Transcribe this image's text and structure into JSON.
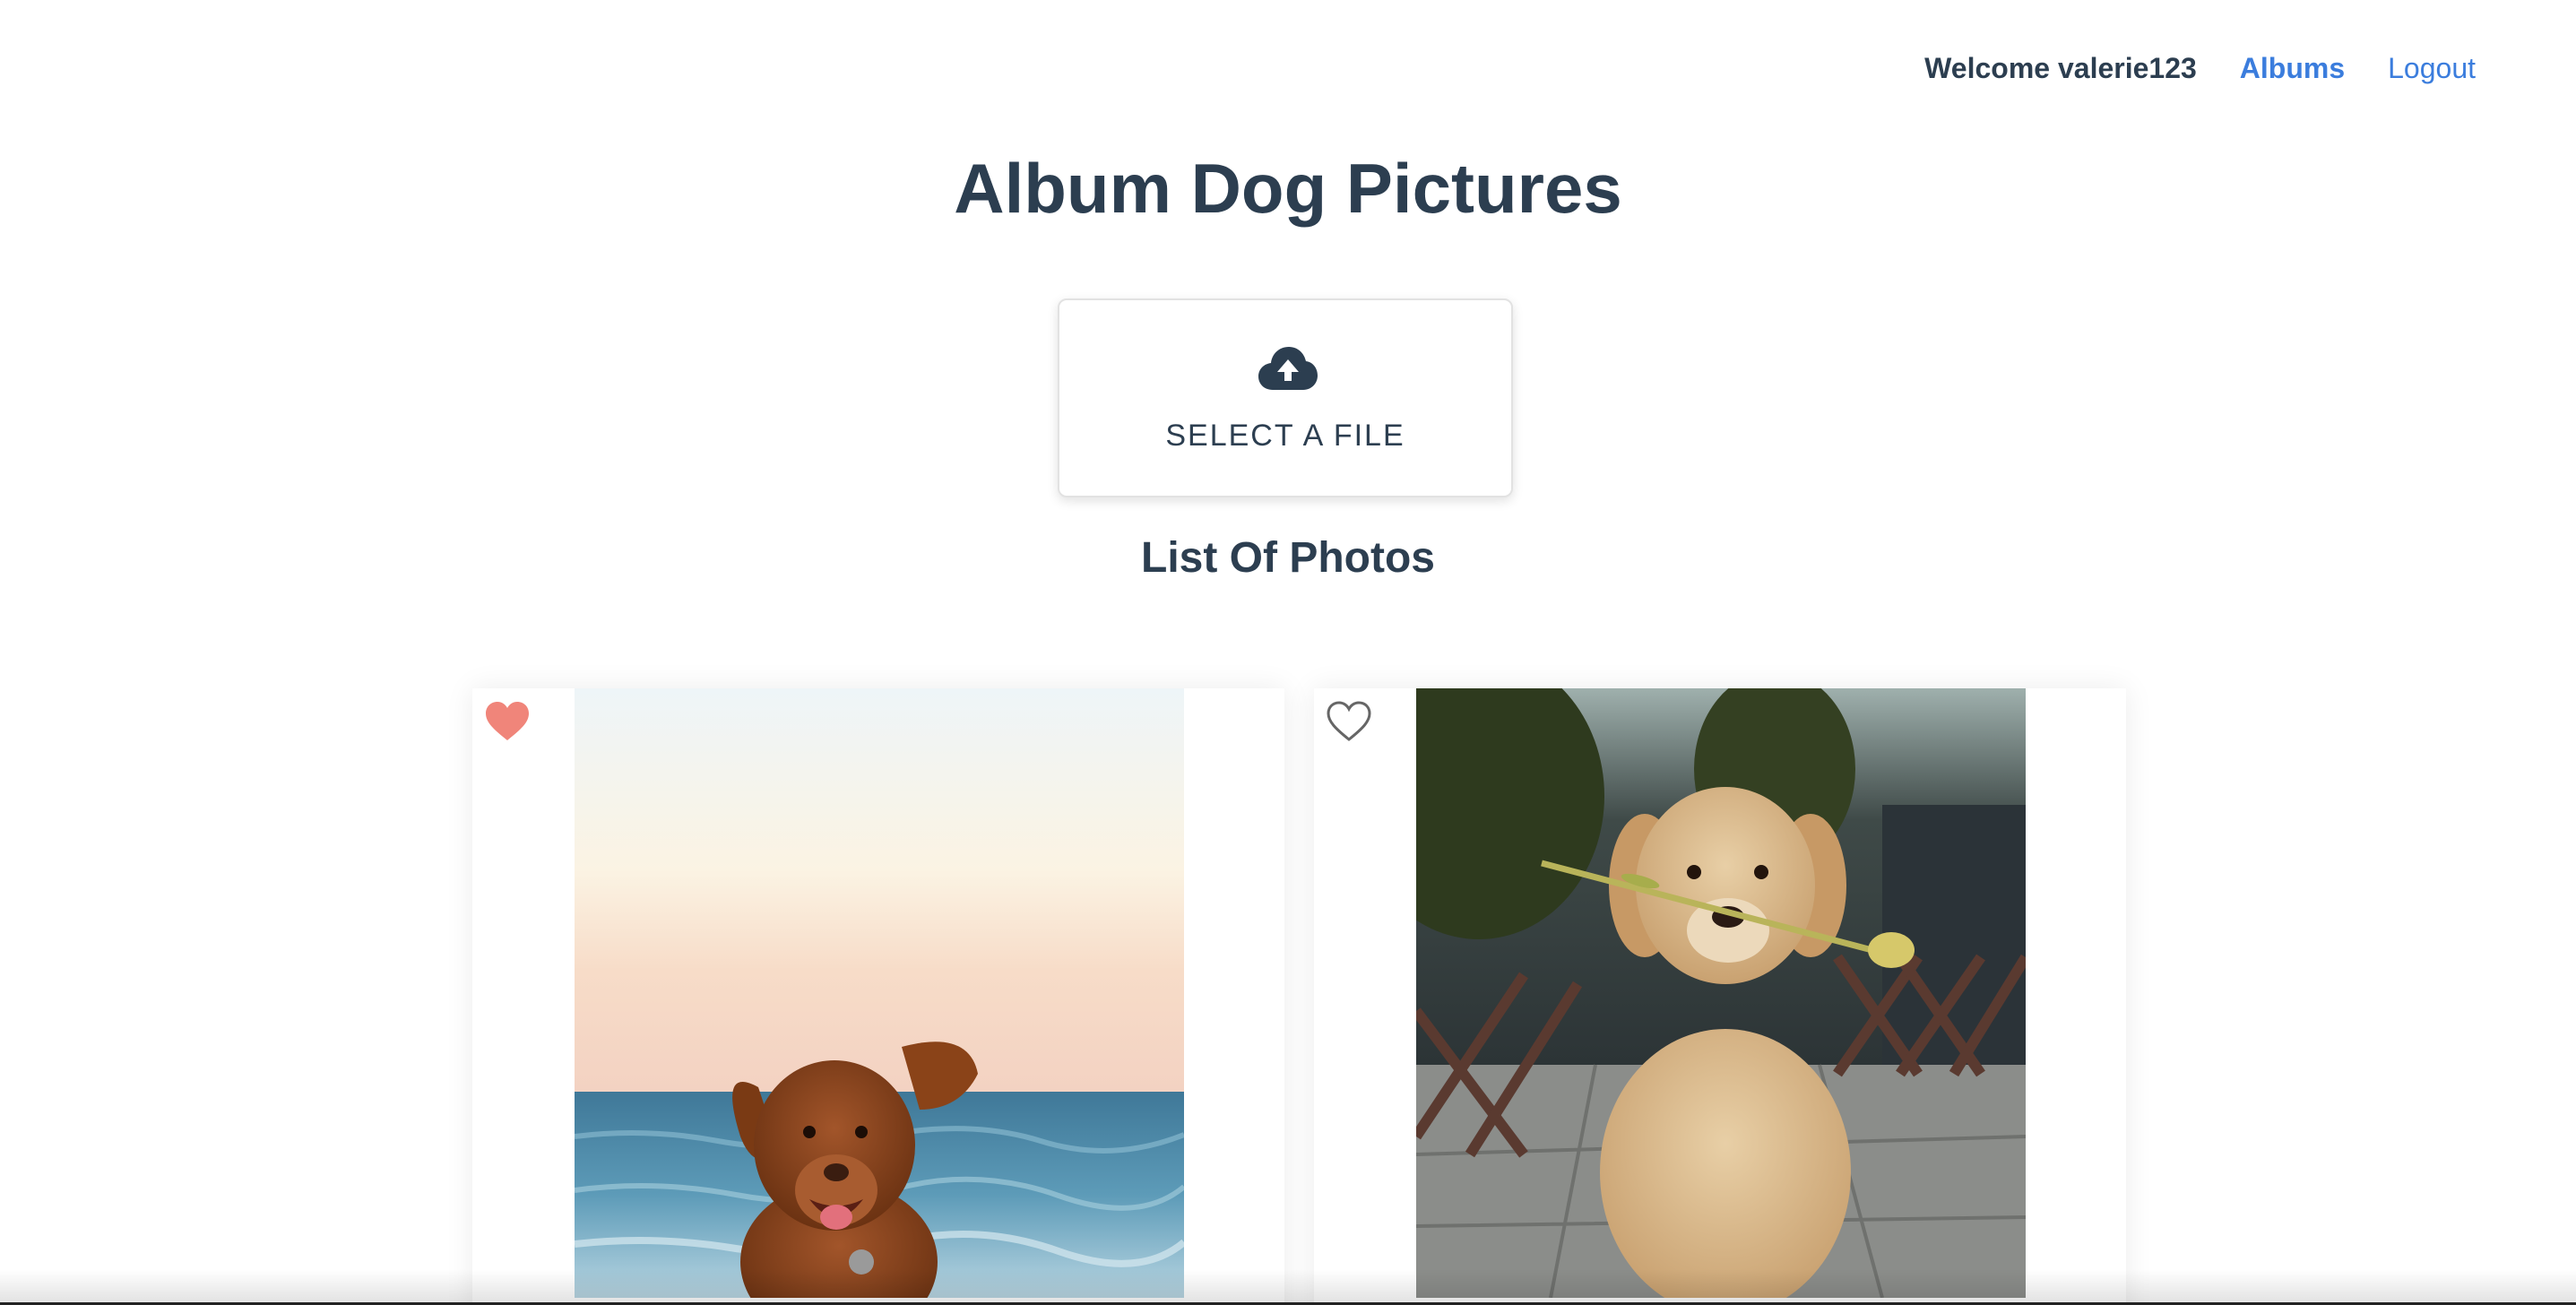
{
  "nav": {
    "welcome": "Welcome valerie123",
    "albums_label": "Albums",
    "logout_label": "Logout"
  },
  "page_title": "Album Dog Pictures",
  "upload": {
    "label": "SELECT A FILE",
    "icon": "cloud-upload-icon"
  },
  "list_title": "List Of Photos",
  "photos": [
    {
      "favorited": true,
      "icon": "heart-filled-icon",
      "alt": "dog at the beach"
    },
    {
      "favorited": false,
      "icon": "heart-outline-icon",
      "alt": "dog with flower"
    }
  ],
  "colors": {
    "text": "#2c3e50",
    "link": "#3b7ddd",
    "heart_filled": "#f0857a",
    "heart_outline": "#666666"
  }
}
